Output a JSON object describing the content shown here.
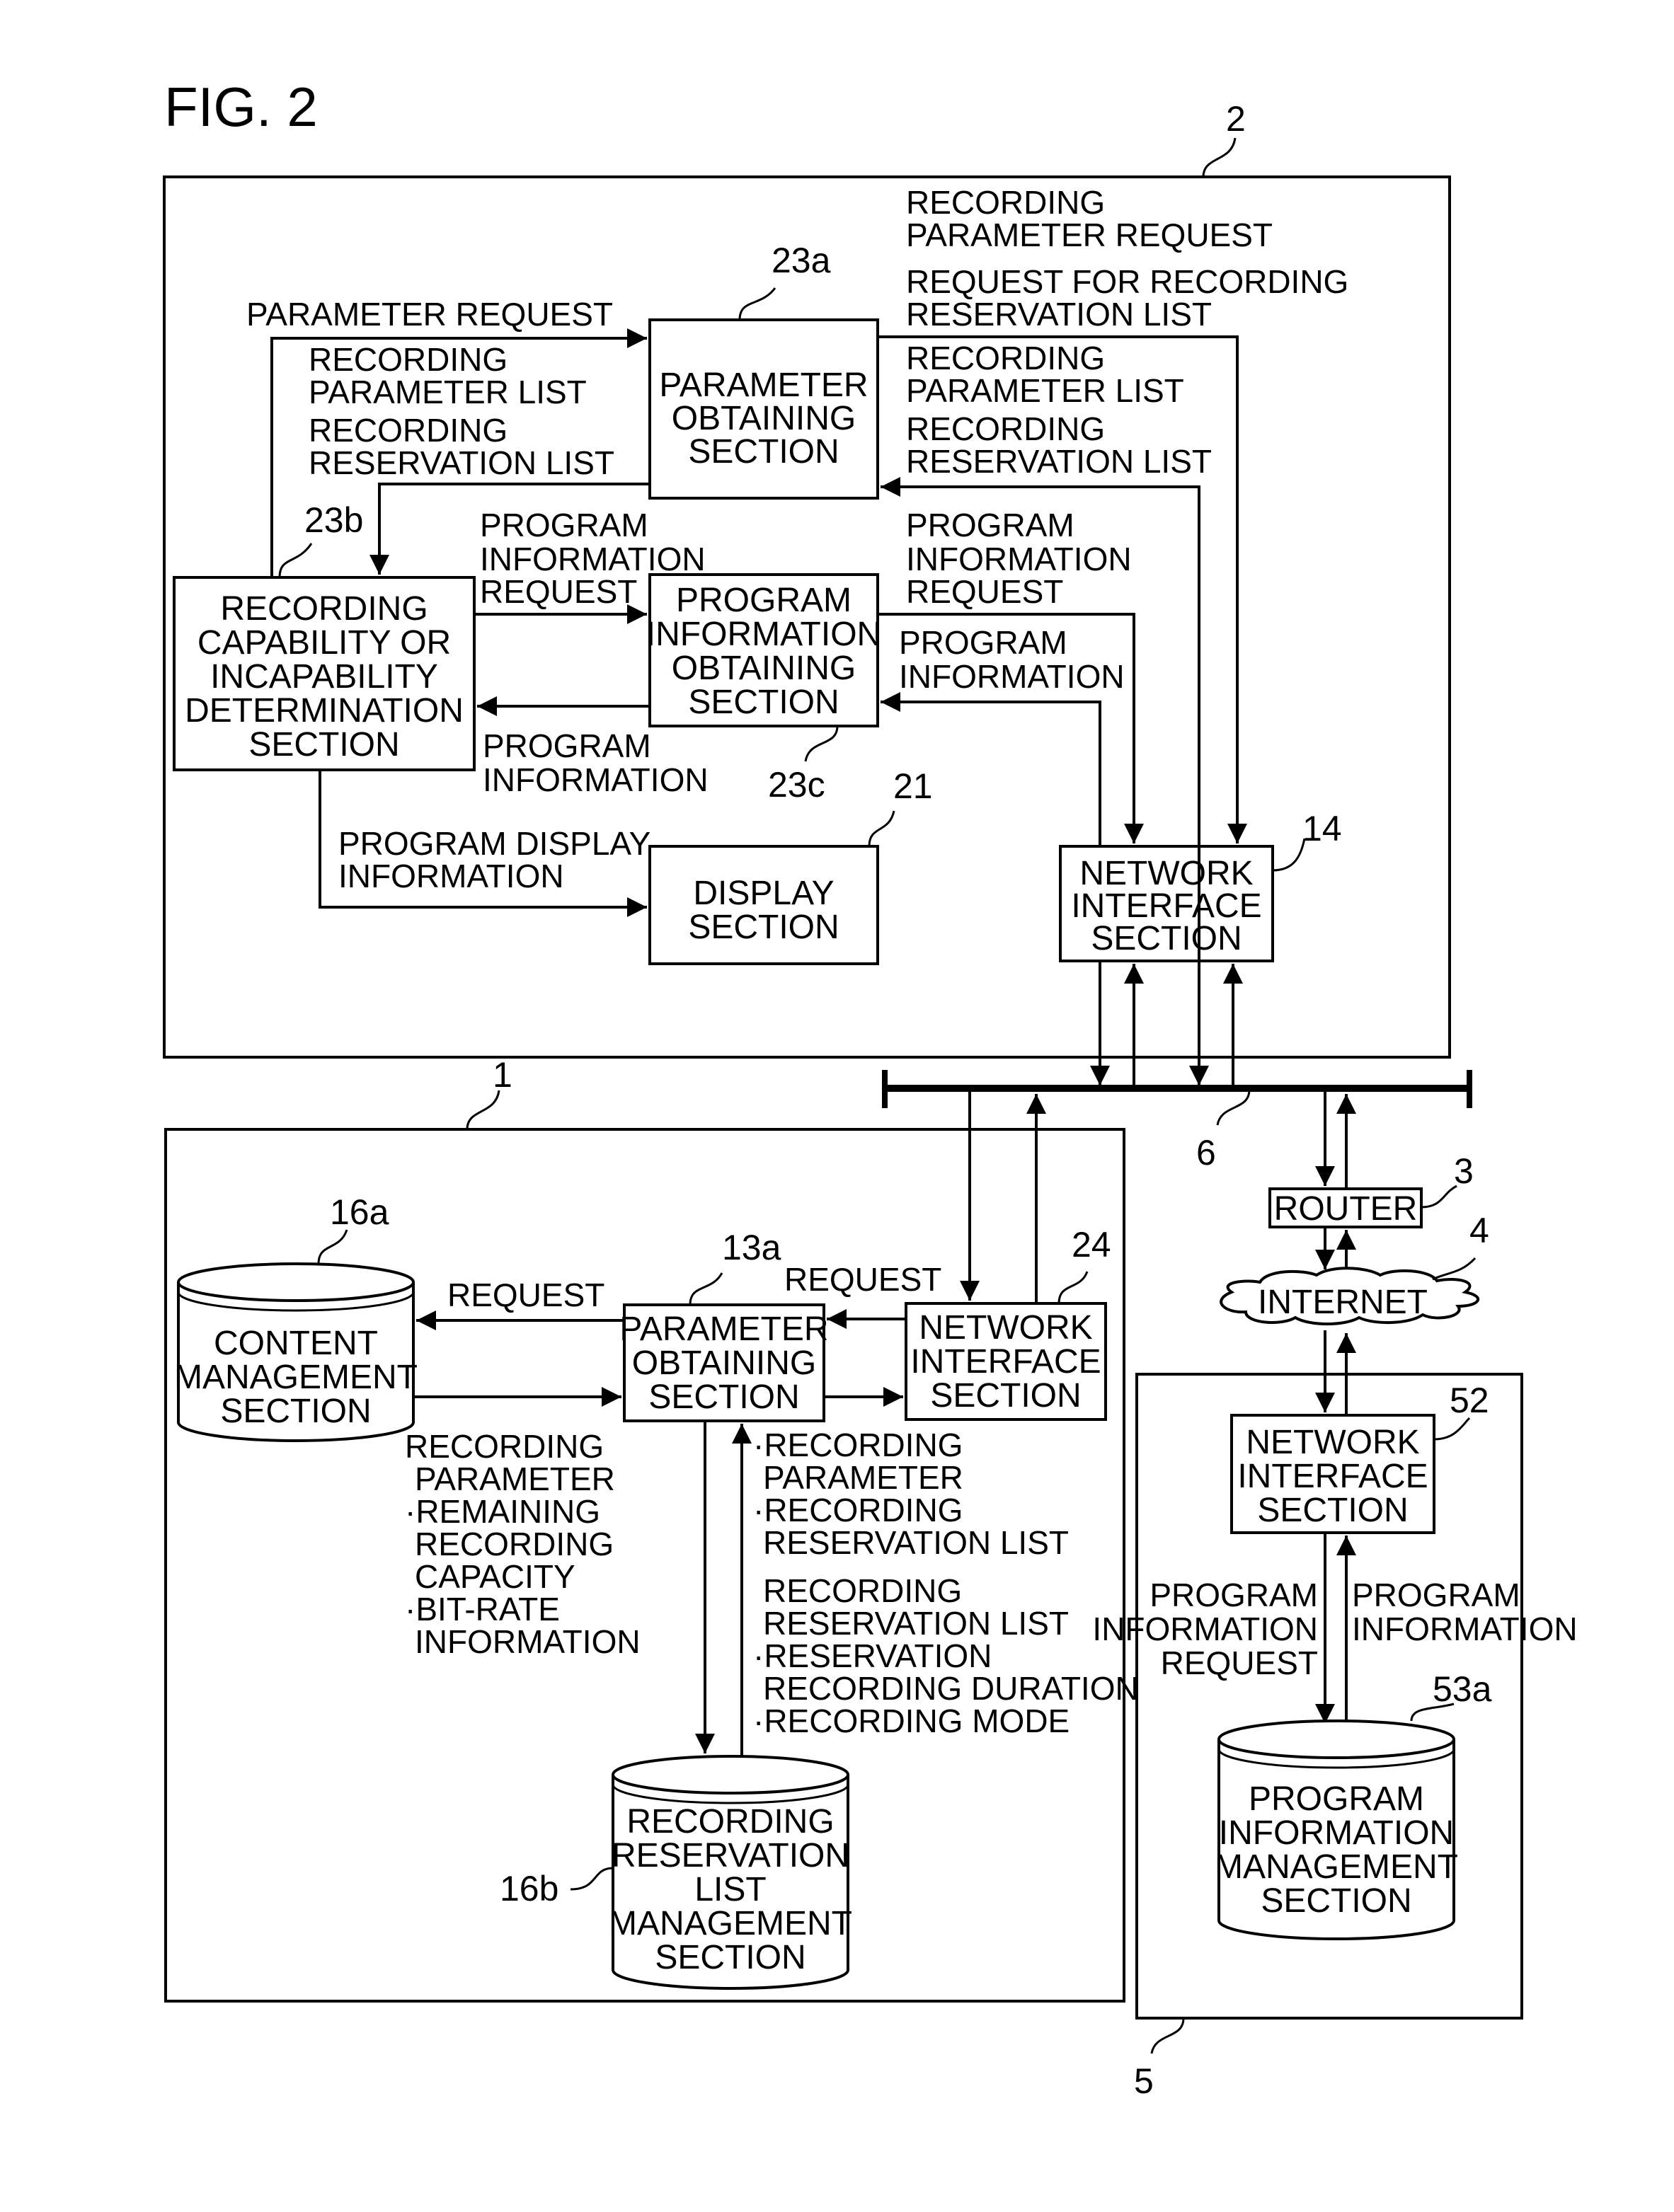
{
  "figure": {
    "title": "FIG. 2",
    "refs": {
      "device2": "2",
      "device1": "1",
      "server5": "5",
      "bus6": "6",
      "router3": "3",
      "internet4": "4",
      "pos23a": "23a",
      "rcd23b": "23b",
      "pio23c": "23c",
      "disp21": "21",
      "nis14": "14",
      "cms16a": "16a",
      "pos13a": "13a",
      "nis24": "24",
      "rrl16b": "16b",
      "nis52": "52",
      "pim53a": "53a"
    },
    "blocks": {
      "pos23a": [
        "PARAMETER",
        "OBTAINING",
        "SECTION"
      ],
      "rcd23b": [
        "RECORDING",
        "CAPABILITY OR",
        "INCAPABILITY",
        "DETERMINATION",
        "SECTION"
      ],
      "pio23c": [
        "PROGRAM",
        "INFORMATION",
        "OBTAINING",
        "SECTION"
      ],
      "disp21": [
        "DISPLAY",
        "SECTION"
      ],
      "nis14": [
        "NETWORK",
        "INTERFACE",
        "SECTION"
      ],
      "cms16a": [
        "CONTENT",
        "MANAGEMENT",
        "SECTION"
      ],
      "pos13a": [
        "PARAMETER",
        "OBTAINING",
        "SECTION"
      ],
      "nis24": [
        "NETWORK",
        "INTERFACE",
        "SECTION"
      ],
      "rrl16b": [
        "RECORDING",
        "RESERVATION",
        "LIST",
        "MANAGEMENT",
        "SECTION"
      ],
      "router3": [
        "ROUTER"
      ],
      "internet4": [
        "INTERNET"
      ],
      "nis52": [
        "NETWORK",
        "INTERFACE",
        "SECTION"
      ],
      "pim53a": [
        "PROGRAM",
        "INFORMATION",
        "MANAGEMENT",
        "SECTION"
      ]
    },
    "labels": {
      "param_request": [
        "PARAMETER REQUEST"
      ],
      "rec_param_list_left": [
        "RECORDING",
        "PARAMETER LIST",
        "RECORDING",
        "RESERVATION LIST"
      ],
      "rec_param_request": [
        "RECORDING",
        "PARAMETER REQUEST"
      ],
      "req_rec_res_list": [
        "REQUEST FOR RECORDING",
        "RESERVATION LIST"
      ],
      "rec_param_list_right": [
        "RECORDING",
        "PARAMETER LIST",
        "RECORDING",
        "RESERVATION LIST"
      ],
      "prog_info_req_mid": [
        "PROGRAM",
        "INFORMATION",
        "REQUEST"
      ],
      "prog_info_req_right": [
        "PROGRAM",
        "INFORMATION",
        "REQUEST"
      ],
      "prog_info_right": [
        "PROGRAM",
        "INFORMATION"
      ],
      "prog_info_mid": [
        "PROGRAM",
        "INFORMATION"
      ],
      "prog_display_info": [
        "PROGRAM DISPLAY",
        "INFORMATION"
      ],
      "request_left": [
        "REQUEST"
      ],
      "request_right": [
        "REQUEST"
      ],
      "cms_output": [
        "RECORDING",
        "PARAMETER",
        "·REMAINING",
        "RECORDING",
        "CAPACITY",
        "·BIT-RATE",
        "INFORMATION"
      ],
      "pos_output": [
        "·RECORDING",
        "PARAMETER",
        "·RECORDING",
        "RESERVATION LIST"
      ],
      "rrl_output": [
        "RECORDING",
        "RESERVATION LIST",
        "·RESERVATION",
        "RECORDING DURATION",
        "·RECORDING MODE"
      ],
      "server_req": [
        "PROGRAM",
        "INFORMATION",
        "REQUEST"
      ],
      "server_info": [
        "PROGRAM",
        "INFORMATION"
      ]
    }
  }
}
